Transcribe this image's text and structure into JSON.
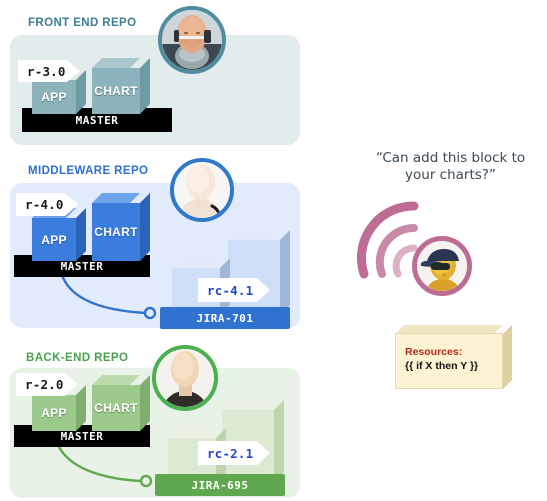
{
  "diagram": {
    "title_hidden": "",
    "panels": [
      {
        "id": "front-end",
        "title": "FRONT END REPO",
        "title_color": "#3d7e92",
        "panel_bg": "#e3ecec",
        "block_color": "#8cb3bb",
        "block_top": "#a9c6cc",
        "block_side": "#6f9aa3",
        "app_label": "APP",
        "chart_label": "CHART",
        "master_label": "MASTER",
        "release_tag": "r-3.0",
        "release_tag_color": "#1a1a1a",
        "avatar_ring": "#4e8c9e",
        "avatar_name": "mannequin-head-with-headset",
        "has_jira": false
      },
      {
        "id": "middleware",
        "title": "MIDDLEWARE REPO",
        "title_color": "#2f6fd0",
        "panel_bg": "#e2ebfb",
        "block_color": "#3b7ddd",
        "block_top": "#6fa3ea",
        "block_side": "#2a63b8",
        "app_label": "APP",
        "chart_label": "CHART",
        "master_label": "MASTER",
        "release_tag": "r-4.0",
        "release_tag_color": "#1a1a1a",
        "avatar_ring": "#2f7ac8",
        "avatar_name": "mannequin-head-plain",
        "has_jira": true,
        "jira_label": "JIRA-701",
        "jira_color": "#2f72cf",
        "jira_block_color": "#cfdef7",
        "jira_block_top": "#e2eaf9",
        "jira_block_side": "#9fb6d9",
        "rc_tag": "rc-4.1",
        "rc_tag_color": "#2547c8",
        "connector_color": "#2f72cf"
      },
      {
        "id": "back-end",
        "title": "BACK-END REPO",
        "title_color": "#49a24b",
        "panel_bg": "#e9f2e6",
        "block_color": "#9cca8c",
        "block_top": "#bcdcae",
        "block_side": "#7fae6f",
        "app_label": "APP",
        "chart_label": "CHART",
        "master_label": "MASTER",
        "release_tag": "r-2.0",
        "release_tag_color": "#1a1a1a",
        "avatar_ring": "#4caf50",
        "avatar_name": "mannequin-head-plain",
        "has_jira": true,
        "jira_label": "JIRA-695",
        "jira_color": "#5fa84f",
        "jira_block_color": "#dcead3",
        "jira_block_top": "#e9f2e2",
        "jira_block_side": "#bdd4ad",
        "rc_tag": "rc-2.1",
        "rc_tag_color": "#2547c8",
        "connector_color": "#5fa84f"
      }
    ],
    "right": {
      "quote_line1": "“Can add this block to",
      "quote_line2": "your charts?”",
      "quote_color": "#3a4a55",
      "signal_icon": "wifi-signal-icon",
      "signal_color": "#bd6d94",
      "avatar_ring": "#bd6d94",
      "avatar_name": "mannequin-head-with-cap-and-sunglasses",
      "resources_title": "Resources:",
      "resources_value": "{{ if X then Y }}",
      "resources_title_color": "#b3281e",
      "resources_box_color": "#fdf3d3"
    }
  }
}
